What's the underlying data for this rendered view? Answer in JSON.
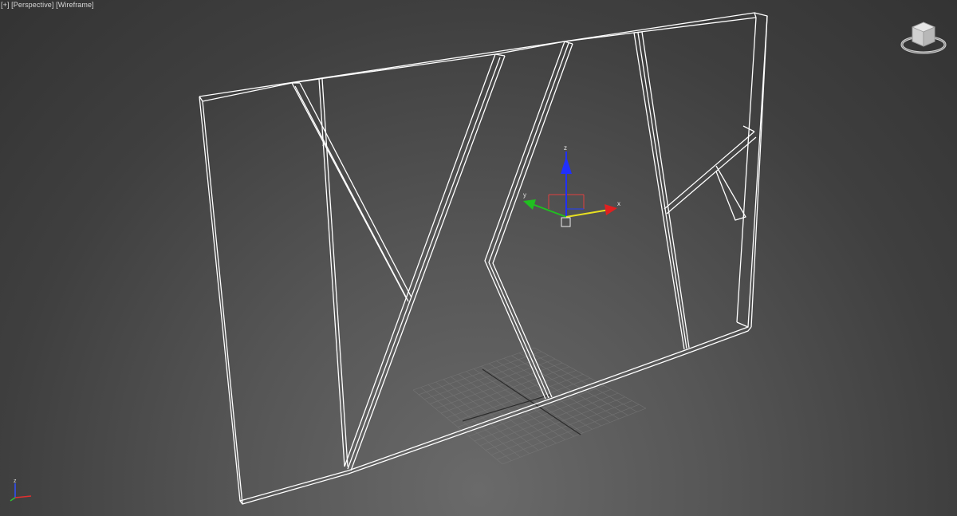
{
  "viewport": {
    "labels": {
      "plus": "[+]",
      "view": "[Perspective]",
      "shading": "[Wireframe]"
    }
  },
  "gizmo": {
    "x_label": "x",
    "y_label": "y",
    "z_label": "z"
  },
  "colors": {
    "background_center": "#6a6a6a",
    "background_edge": "#333333",
    "wireframe": "#ffffff",
    "grid": "#7a7a7a",
    "axis_x": "#e02020",
    "axis_y": "#20c020",
    "axis_z": "#2030ff"
  },
  "icons": [
    "viewcube-icon",
    "axis-tripod-icon",
    "move-gizmo-icon"
  ]
}
